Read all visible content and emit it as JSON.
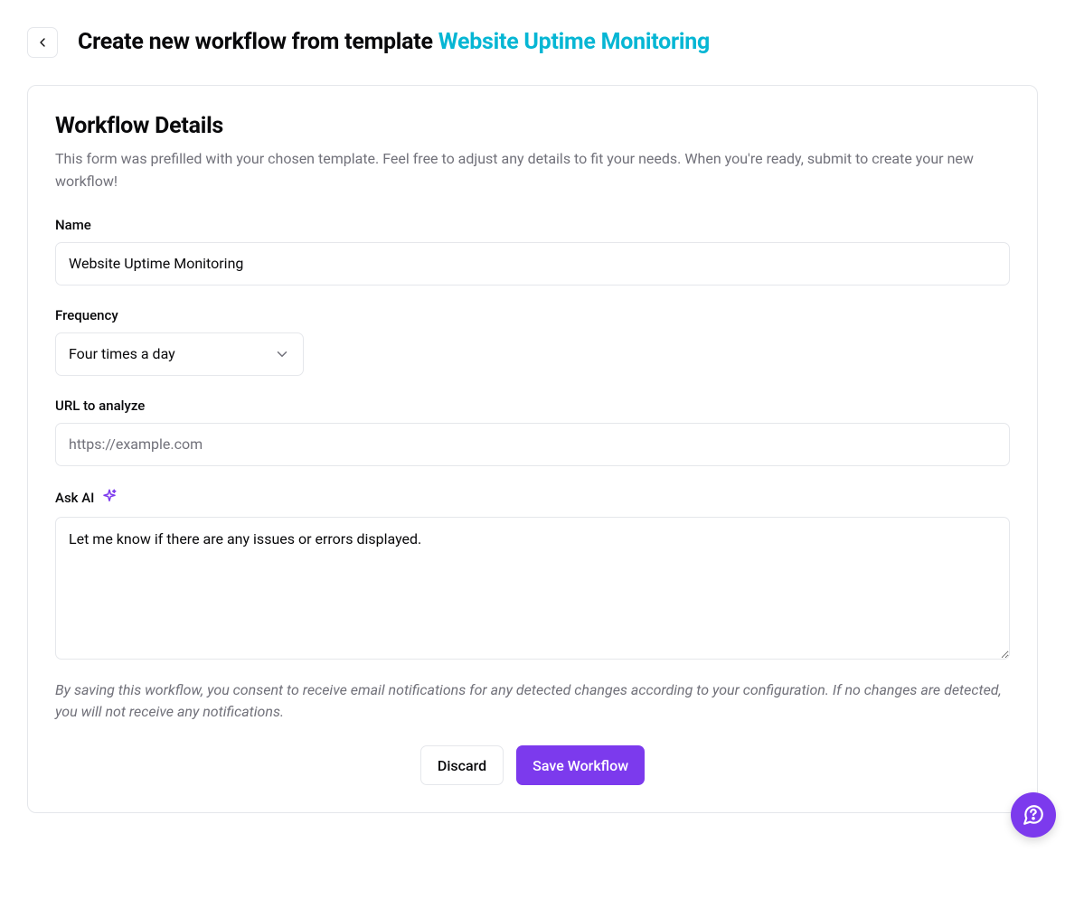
{
  "header": {
    "prefix": "Create new workflow from template ",
    "template_name": "Website Uptime Monitoring"
  },
  "card": {
    "title": "Workflow Details",
    "subtitle": "This form was prefilled with your chosen template. Feel free to adjust any details to fit your needs. When you're ready, submit to create your new workflow!"
  },
  "form": {
    "name_label": "Name",
    "name_value": "Website Uptime Monitoring",
    "frequency_label": "Frequency",
    "frequency_value": "Four times a day",
    "url_label": "URL to analyze",
    "url_placeholder": "https://example.com",
    "url_value": "",
    "askai_label": "Ask AI",
    "askai_value": "Let me know if there are any issues or errors displayed."
  },
  "consent": "By saving this workflow, you consent to receive email notifications for any detected changes according to your configuration. If no changes are detected, you will not receive any notifications.",
  "buttons": {
    "discard": "Discard",
    "save": "Save Workflow"
  }
}
